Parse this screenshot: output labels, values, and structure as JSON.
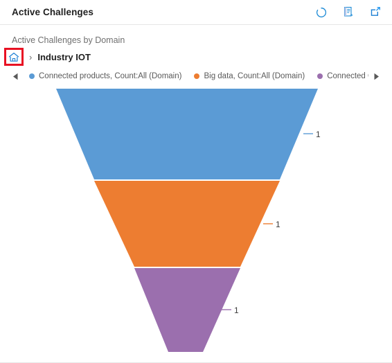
{
  "header": {
    "title": "Active Challenges",
    "actions": [
      {
        "name": "refresh-icon",
        "label": "Refresh"
      },
      {
        "name": "export-records-icon",
        "label": "Export Records"
      },
      {
        "name": "popout-icon",
        "label": "Pop Out Chart"
      }
    ]
  },
  "chart_header": {
    "title": "Active Challenges by Domain",
    "breadcrumb": {
      "home_icon": "home-icon",
      "separator": "›",
      "current": "Industry IOT"
    }
  },
  "legend": {
    "scroll_left": "◀",
    "scroll_right": "▶",
    "items": [
      {
        "label": "Connected products, Count:All (Domain)",
        "color": "#5B9BD5"
      },
      {
        "label": "Big data, Count:All (Domain)",
        "color": "#ED7D31"
      },
      {
        "label": "Connected Opera",
        "color": "#9B6FAE"
      }
    ]
  },
  "chart_data": {
    "type": "funnel",
    "title": "Active Challenges by Domain",
    "xlabel": "",
    "ylabel": "",
    "categories": [
      "Connected products, Count:All (Domain)",
      "Big data, Count:All (Domain)",
      "Connected Opera"
    ],
    "values": [
      1,
      1,
      1
    ],
    "value_labels": [
      "1",
      "1",
      "1"
    ],
    "colors": [
      "#5B9BD5",
      "#ED7D31",
      "#9B6FAE"
    ],
    "legend_position": "top",
    "grid": false,
    "series": [
      {
        "name": "Count:All (Domain)",
        "values": [
          1,
          1,
          1
        ]
      }
    ]
  },
  "colors": {
    "accent": "#0078d4",
    "highlight_box": "#e81123",
    "series_blue": "#5B9BD5",
    "series_orange": "#ED7D31",
    "series_purple": "#9B6FAE"
  }
}
